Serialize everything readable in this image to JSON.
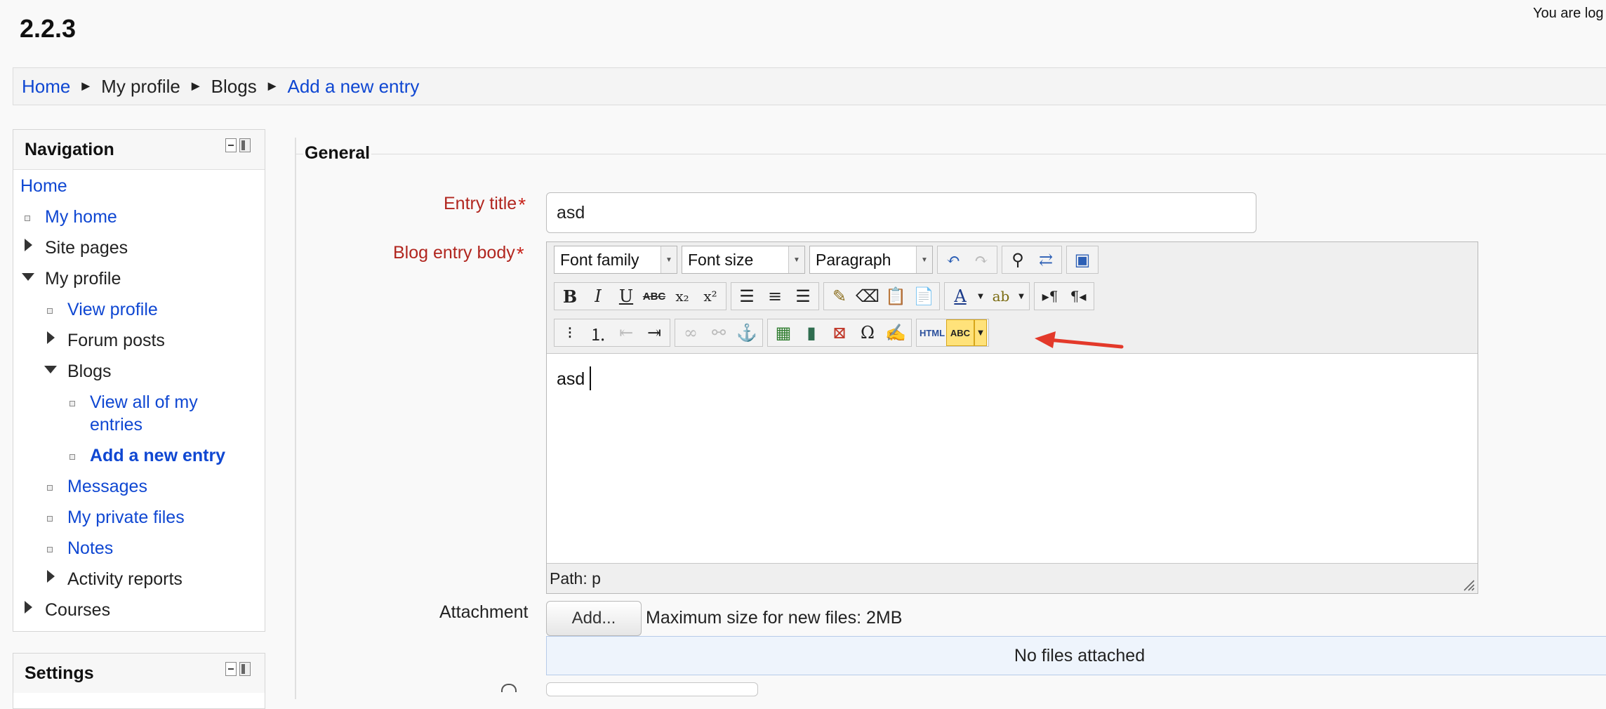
{
  "header": {
    "site_title": "2.2.3",
    "login_text": "You are log"
  },
  "breadcrumb": {
    "items": [
      {
        "label": "Home",
        "link": true
      },
      {
        "label": "My profile",
        "link": false
      },
      {
        "label": "Blogs",
        "link": false
      },
      {
        "label": "Add a new entry",
        "link": true
      }
    ],
    "separator": "►"
  },
  "navigation": {
    "title": "Navigation",
    "home": "Home",
    "my_home": "My home",
    "site_pages": "Site pages",
    "my_profile": "My profile",
    "view_profile": "View profile",
    "forum_posts": "Forum posts",
    "blogs": "Blogs",
    "view_all_line1": "View all of my",
    "view_all_line2": "entries",
    "add_new_entry": "Add a new entry",
    "messages": "Messages",
    "private_files": "My private files",
    "notes": "Notes",
    "activity_reports": "Activity reports",
    "courses": "Courses"
  },
  "settings": {
    "title": "Settings"
  },
  "form": {
    "legend": "General",
    "entry_title_label": "Entry title",
    "entry_title_value": "asd",
    "body_label": "Blog entry body",
    "required_mark": "*",
    "editor": {
      "font_family": "Font family",
      "font_size": "Font size",
      "paragraph": "Paragraph",
      "content": "asd",
      "path": "Path: p",
      "html_label": "HTML",
      "spell_label": "ABC"
    },
    "attachment_label": "Attachment",
    "add_button": "Add...",
    "max_size": "Maximum size for new files: 2MB",
    "no_files": "No files attached"
  },
  "colors": {
    "link": "#0f47d2",
    "required": "#b1261f",
    "annotation_arrow": "#e3392a"
  }
}
